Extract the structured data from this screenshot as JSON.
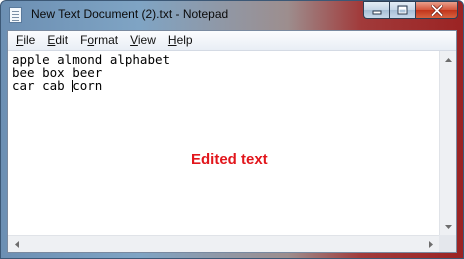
{
  "window": {
    "title": "New Text Document (2).txt - Notepad"
  },
  "caption_buttons": {
    "minimize": "minimize-icon",
    "maximize": "maximize-icon",
    "close": "close-icon"
  },
  "menu": {
    "items": [
      {
        "mnemonic": "F",
        "rest": "ile"
      },
      {
        "mnemonic": "E",
        "rest": "dit"
      },
      {
        "mnemonic": "F",
        "rest": "o",
        "full": "Format"
      },
      {
        "mnemonic": "V",
        "rest": "iew"
      },
      {
        "mnemonic": "H",
        "rest": "elp"
      }
    ],
    "labels": [
      "File",
      "Edit",
      "Format",
      "View",
      "Help"
    ]
  },
  "editor": {
    "line1": "apple almond alphabet",
    "line2": "bee box beer",
    "line3_before_caret": "car cab ",
    "line3_after_caret": "corn"
  },
  "annotation": {
    "text": "Edited text",
    "color": "#e2161c"
  },
  "colors": {
    "close_button": "#c2341b",
    "titlebar_blue": "#7fa4c4",
    "titlebar_red": "#9b2323"
  }
}
